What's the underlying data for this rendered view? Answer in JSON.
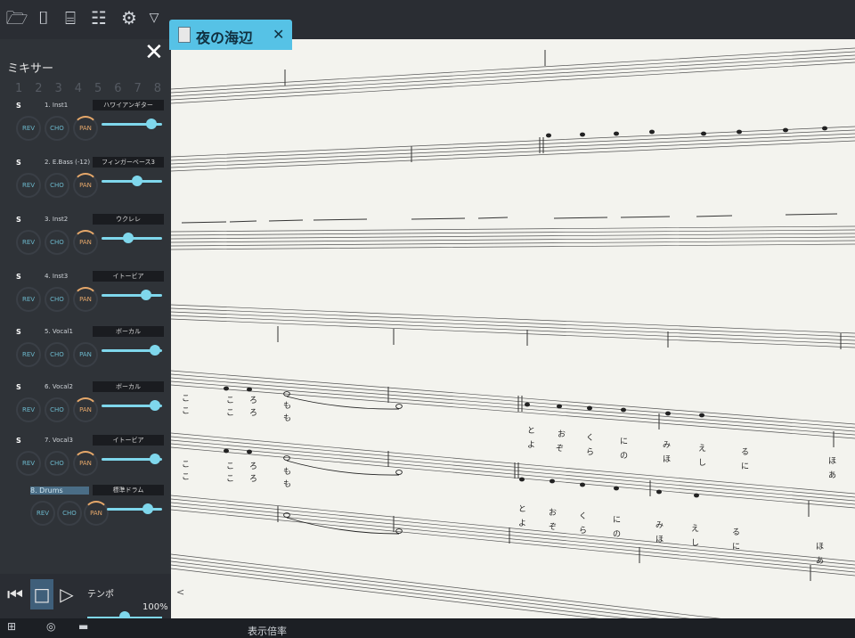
{
  "toolbar": {
    "icons": [
      "folder-open-icon",
      "save-icon",
      "save-as-icon",
      "document-icon",
      "settings-check-icon",
      "dropdown-icon"
    ]
  },
  "mixer": {
    "title": "ミキサー",
    "close": "✕",
    "numbers": [
      "1",
      "2",
      "3",
      "4",
      "5",
      "6",
      "7",
      "8"
    ],
    "tracks": [
      {
        "s": "S",
        "name": "1. Inst1",
        "inst": "ハワイアンギター",
        "rev": "REV",
        "cho": "CHO",
        "pan": "PAN"
      },
      {
        "s": "S",
        "name": "2. E.Bass (-12)",
        "inst": "フィンガーベース3",
        "rev": "REV",
        "cho": "CHO",
        "pan": "PAN"
      },
      {
        "s": "S",
        "name": "3. Inst2",
        "inst": "ウクレレ",
        "rev": "REV",
        "cho": "CHO",
        "pan": "PAN"
      },
      {
        "s": "S",
        "name": "4. Inst3",
        "inst": "イトービア",
        "rev": "REV",
        "cho": "CHO",
        "pan": "PAN"
      },
      {
        "s": "S",
        "name": "5. Vocal1",
        "inst": "ボーカル",
        "rev": "REV",
        "cho": "CHO",
        "pan": "PAN"
      },
      {
        "s": "S",
        "name": "6. Vocal2",
        "inst": "ボーカル",
        "rev": "REV",
        "cho": "CHO",
        "pan": "PAN"
      },
      {
        "s": "S",
        "name": "7. Vocal3",
        "inst": "イトービア",
        "rev": "REV",
        "cho": "CHO",
        "pan": "PAN"
      },
      {
        "s": "S",
        "name": "8. Drums",
        "inst": "標準ドラム",
        "rev": "REV",
        "cho": "CHO",
        "pan": "PAN"
      }
    ]
  },
  "transport": {
    "tempo_label": "テンポ",
    "tempo_value": "100%"
  },
  "tab": {
    "title": "夜の海辺",
    "close": "✕"
  },
  "lyrics": {
    "row1_a": [
      "こ",
      "こ",
      "ろ",
      "も"
    ],
    "row1_b": [
      "こ",
      "こ",
      "ろ",
      "も"
    ],
    "row1_c": [
      "と",
      "お",
      "く",
      "に",
      "み",
      "え",
      "る"
    ],
    "row1_d": [
      "よ",
      "ぞ",
      "ら",
      "の",
      "ほ",
      "し",
      "に"
    ],
    "row2_a": [
      "こ",
      "こ",
      "ろ",
      "も"
    ],
    "row2_b": [
      "こ",
      "こ",
      "ろ",
      "も"
    ],
    "row2_c": [
      "と",
      "お",
      "く",
      "に",
      "み",
      "え",
      "る"
    ],
    "row2_d": [
      "よ",
      "ぞ",
      "ら",
      "の",
      "ほ",
      "し",
      "に"
    ],
    "tail_a": [
      "ほ",
      "あ"
    ],
    "tail_b": [
      "ほ",
      "あ"
    ]
  },
  "status": {
    "zoom_label": "表示倍率"
  },
  "colors": {
    "accent": "#56c2e6",
    "slider": "#7fd7ec",
    "pan": "#e6a86a"
  }
}
